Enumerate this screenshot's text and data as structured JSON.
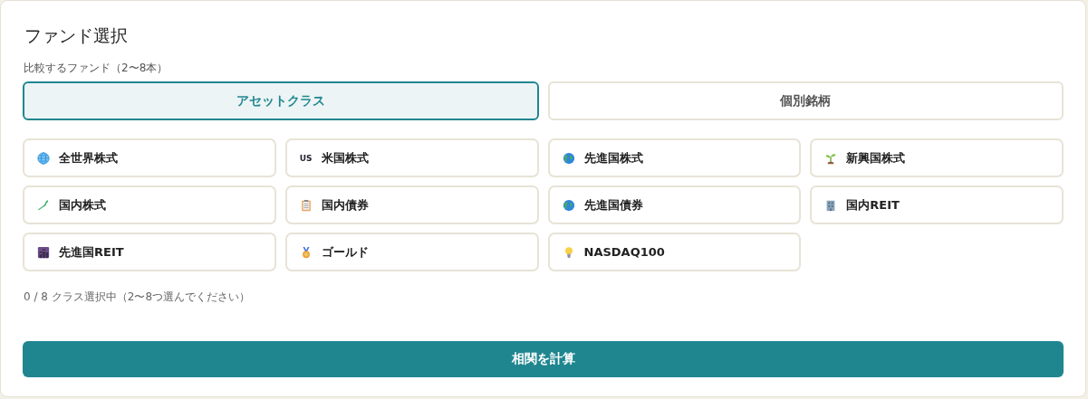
{
  "title": "ファンド選択",
  "field_label": "比較するファンド（2〜8本）",
  "tabs": [
    {
      "label": "アセットクラス",
      "selected": true
    },
    {
      "label": "個別銘柄",
      "selected": false
    }
  ],
  "funds": [
    {
      "label": "全世界株式",
      "selected": false
    },
    {
      "label": "米国株式",
      "badge": "US",
      "selected": false
    },
    {
      "label": "先進国株式",
      "selected": false
    },
    {
      "label": "新興国株式",
      "selected": false
    },
    {
      "label": "国内株式",
      "selected": false
    },
    {
      "label": "国内債券",
      "selected": false
    },
    {
      "label": "先進国債券",
      "selected": false
    },
    {
      "label": "国内REIT",
      "selected": false
    },
    {
      "label": "先進国REIT",
      "selected": false
    },
    {
      "label": "ゴールド",
      "selected": false
    },
    {
      "label": "NASDAQ100",
      "selected": false
    }
  ],
  "status": "0 / 8 クラス選択中（2〜8つ選んでください）",
  "submit": "相関を計算"
}
